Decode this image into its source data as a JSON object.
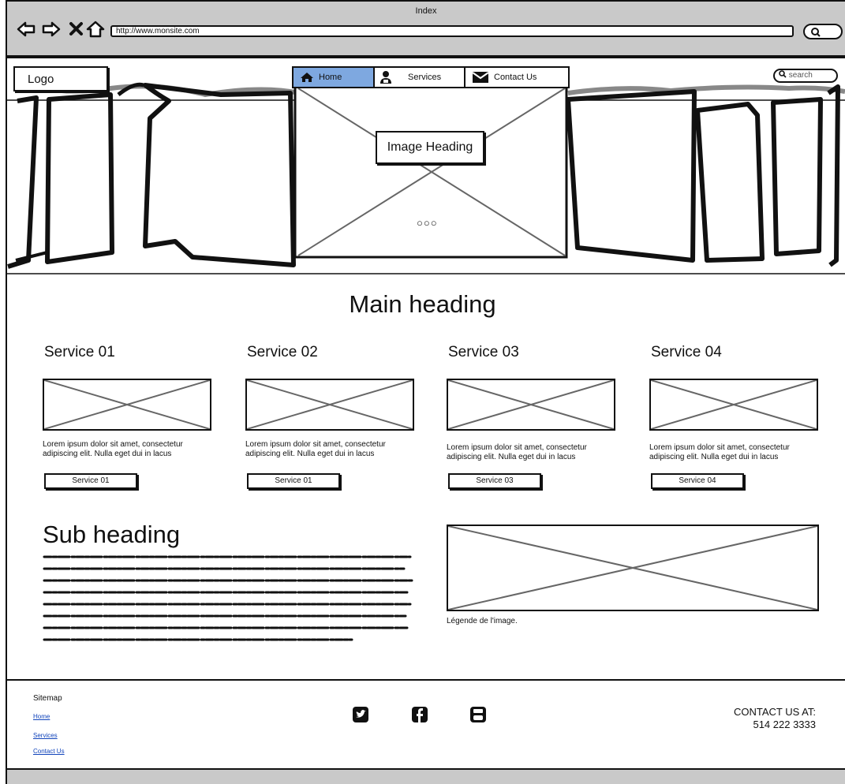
{
  "browser": {
    "title": "Index",
    "url": "http://www.monsite.com"
  },
  "header": {
    "logo": "Logo",
    "nav": [
      {
        "label": "Home",
        "icon": "home-icon"
      },
      {
        "label": "Services",
        "icon": "user-icon"
      },
      {
        "label": "Contact Us",
        "icon": "envelope-icon"
      }
    ],
    "search_placeholder": "search"
  },
  "carousel": {
    "heading": "Image Heading",
    "dots": "○○○"
  },
  "main": {
    "heading": "Main heading",
    "services": [
      {
        "title": "Service 01",
        "desc_line1": "Lorem ipsum dolor sit amet, consectetur",
        "desc_line2": "adipiscing elit. Nulla eget dui in lacus",
        "button": "Service 01"
      },
      {
        "title": "Service 02",
        "desc_line1": "Lorem ipsum dolor sit amet, consectetur",
        "desc_line2": "adipiscing elit. Nulla eget dui in lacus",
        "button": "Service 01"
      },
      {
        "title": "Service 03",
        "desc_line1": "Lorem ipsum dolor sit amet, consectetur",
        "desc_line2": "adipiscing elit. Nulla eget dui in lacus",
        "button": "Service 03"
      },
      {
        "title": "Service 04",
        "desc_line1": "Lorem ipsum dolor sit amet, consectetur",
        "desc_line2": "adipiscing elit. Nulla eget dui in lacus",
        "button": "Service 04"
      }
    ],
    "sub_heading": "Sub heading",
    "image_caption": "Légende de l'image."
  },
  "footer": {
    "sitemap_label": "Sitemap",
    "links": [
      "Home",
      "Services",
      "Contact Us"
    ],
    "social_icons": [
      "twitter-icon",
      "facebook-icon",
      "youtube-icon"
    ],
    "contact_label": "CONTACT US AT:",
    "contact_phone": "514 222 3333"
  },
  "colors": {
    "active_nav": "#7ea8e0",
    "chrome": "#c9c9c9",
    "link": "#1144bb"
  }
}
